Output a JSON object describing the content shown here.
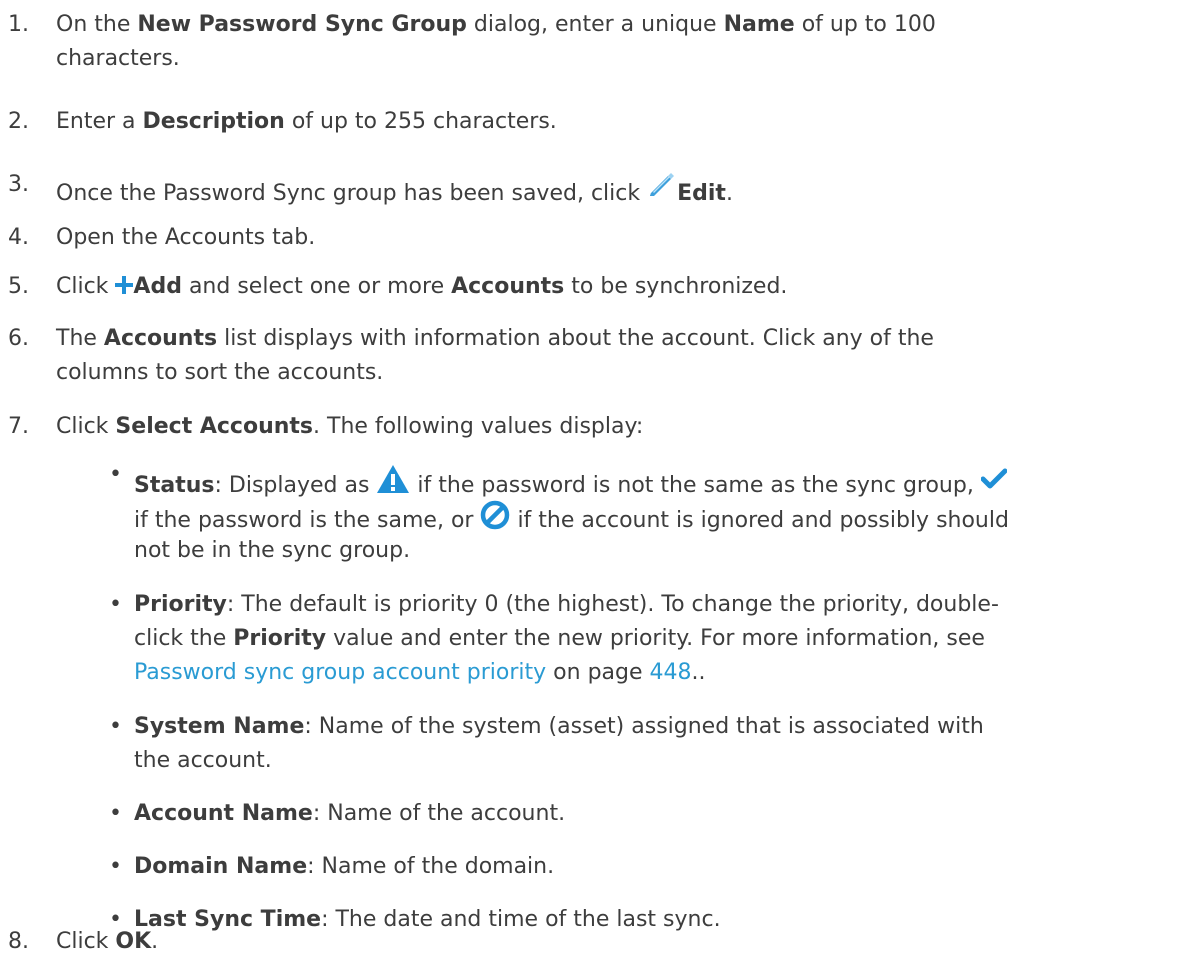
{
  "steps": [
    {
      "num": "1.",
      "pre": "On the ",
      "b1": "New Password Sync Group",
      "mid": " dialog, enter a unique ",
      "b2": "Name",
      "post": " of up to 100",
      "line2": "characters."
    },
    {
      "num": "2.",
      "pre": "Enter a ",
      "b1": "Description",
      "post": " of up to 255 characters."
    },
    {
      "num": "3.",
      "pre": "Once the Password Sync group has been saved, click ",
      "icon": "pencil-edit-icon",
      "b1": "Edit",
      "post": "."
    },
    {
      "num": "4.",
      "text": "Open the Accounts tab."
    },
    {
      "num": "5.",
      "pre": "Click ",
      "icon": "plus-icon",
      "b1": "Add",
      "mid": " and select one or more ",
      "b2": "Accounts",
      "post": " to be synchronized."
    },
    {
      "num": "6.",
      "pre": "The ",
      "b1": "Accounts",
      "post": " list displays with information about the account. Click any of the",
      "line2": "columns to sort the accounts."
    },
    {
      "num": "7.",
      "pre": "Click ",
      "b1": "Select Accounts",
      "post": ". The following values display:"
    },
    {
      "num": "8.",
      "pre": "Click ",
      "b1": "OK",
      "post": "."
    }
  ],
  "bullets": [
    {
      "term": "Status",
      "a": ": Displayed as ",
      "icon1": "warning-triangle-icon",
      "b": " if the password is not the same as the sync group, ",
      "icon2": "checkmark-icon",
      "c": "if the password is the same, or ",
      "icon3": "ignored-circle-icon",
      "d": " if the account is ignored and possibly should",
      "line3": "not be in the sync group."
    },
    {
      "term": "Priority",
      "a": ": The default is priority 0 (the highest). To change the priority, double-",
      "b": "click the ",
      "term2": "Priority",
      "c": " value and enter the new priority. For more information, see",
      "link": "Password sync group account priority",
      "d": " on page ",
      "page": "448",
      "e": ".."
    },
    {
      "term": "System Name",
      "a": ": Name of the system (asset) assigned that is associated with",
      "line2": "the account."
    },
    {
      "term": "Account Name",
      "a": ": Name of the account."
    },
    {
      "term": "Domain Name",
      "a": ": Name of the domain."
    },
    {
      "term": "Last Sync Time",
      "a": ": The date and time of the last sync."
    }
  ],
  "colors": {
    "text": "#3d3d3d",
    "link": "#2a9bd3",
    "icon_blue": "#1f8fd6"
  }
}
